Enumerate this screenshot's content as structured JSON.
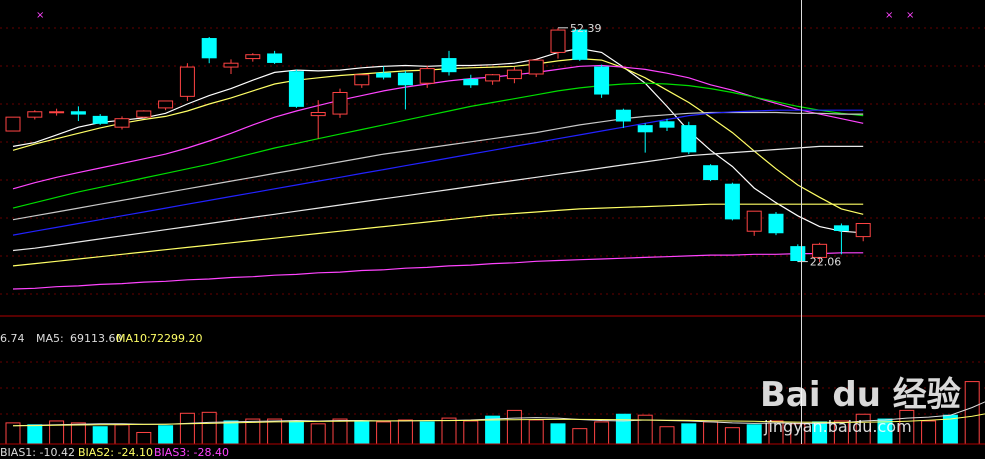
{
  "chart_data": {
    "type": "candlestick",
    "price": {
      "ylim": [
        15,
        56
      ],
      "candles": [
        {
          "o": 39.0,
          "h": 40.5,
          "c": 40.8,
          "l": 39.0
        },
        {
          "o": 40.8,
          "h": 41.7,
          "c": 41.5,
          "l": 40.5
        },
        {
          "o": 41.5,
          "h": 41.9,
          "c": 41.5,
          "l": 41.0
        },
        {
          "o": 41.5,
          "h": 42.2,
          "c": 41.2,
          "l": 40.3
        },
        {
          "o": 40.9,
          "h": 41.2,
          "c": 40.0,
          "l": 39.8
        },
        {
          "o": 39.5,
          "h": 40.9,
          "c": 40.6,
          "l": 39.2
        },
        {
          "o": 40.8,
          "h": 41.7,
          "c": 41.6,
          "l": 40.7
        },
        {
          "o": 42.0,
          "h": 42.8,
          "c": 42.9,
          "l": 41.7
        },
        {
          "o": 43.5,
          "h": 47.8,
          "c": 47.3,
          "l": 42.9
        },
        {
          "o": 51.0,
          "h": 51.2,
          "c": 48.5,
          "l": 47.8
        },
        {
          "o": 47.3,
          "h": 48.3,
          "c": 47.8,
          "l": 46.4
        },
        {
          "o": 48.4,
          "h": 49.1,
          "c": 48.9,
          "l": 48.0
        },
        {
          "o": 49.0,
          "h": 49.4,
          "c": 47.9,
          "l": 47.7
        },
        {
          "o": 46.7,
          "h": 47.0,
          "c": 42.2,
          "l": 42.0
        },
        {
          "o": 41.0,
          "h": 43.0,
          "c": 41.4,
          "l": 38.0
        },
        {
          "o": 41.2,
          "h": 44.5,
          "c": 44.0,
          "l": 40.7
        },
        {
          "o": 45.0,
          "h": 46.0,
          "c": 46.3,
          "l": 44.6
        },
        {
          "o": 46.5,
          "h": 47.4,
          "c": 46.0,
          "l": 45.7
        },
        {
          "o": 46.5,
          "h": 46.8,
          "c": 45.0,
          "l": 41.8
        },
        {
          "o": 45.2,
          "h": 47.5,
          "c": 47.1,
          "l": 44.6
        },
        {
          "o": 48.4,
          "h": 49.4,
          "c": 46.7,
          "l": 46.2
        },
        {
          "o": 45.7,
          "h": 46.3,
          "c": 45.0,
          "l": 44.6
        },
        {
          "o": 45.5,
          "h": 46.4,
          "c": 46.3,
          "l": 45.0
        },
        {
          "o": 45.8,
          "h": 47.3,
          "c": 46.9,
          "l": 45.2
        },
        {
          "o": 46.4,
          "h": 47.0,
          "c": 48.2,
          "l": 46.0
        },
        {
          "o": 49.2,
          "h": 52.4,
          "c": 52.1,
          "l": 48.4
        },
        {
          "o": 52.1,
          "h": 52.2,
          "c": 48.3,
          "l": 48.1
        },
        {
          "o": 47.3,
          "h": 47.6,
          "c": 43.8,
          "l": 43.3
        },
        {
          "o": 41.7,
          "h": 41.9,
          "c": 40.3,
          "l": 39.4
        },
        {
          "o": 39.7,
          "h": 40.0,
          "c": 38.9,
          "l": 36.2
        },
        {
          "o": 40.2,
          "h": 40.6,
          "c": 39.5,
          "l": 39.0
        },
        {
          "o": 39.7,
          "h": 40.2,
          "c": 36.3,
          "l": 36.0
        },
        {
          "o": 34.5,
          "h": 34.7,
          "c": 32.7,
          "l": 32.5
        },
        {
          "o": 32.1,
          "h": 32.3,
          "c": 27.6,
          "l": 27.4
        },
        {
          "o": 26.0,
          "h": 28.1,
          "c": 28.6,
          "l": 25.4
        },
        {
          "o": 28.2,
          "h": 28.5,
          "c": 25.8,
          "l": 25.5
        },
        {
          "o": 24.0,
          "h": 24.3,
          "c": 22.2,
          "l": 22.0
        },
        {
          "o": 22.6,
          "h": 24.5,
          "c": 24.3,
          "l": 22.0
        },
        {
          "o": 26.7,
          "h": 27.0,
          "c": 26.1,
          "l": 23.0
        },
        {
          "o": 25.3,
          "h": 26.3,
          "c": 27.0,
          "l": 24.7
        }
      ],
      "moving_averages": [
        {
          "color": "#ffffff",
          "values": [
            37.0,
            37.5,
            38.5,
            39.5,
            40.1,
            40.4,
            40.7,
            41.3,
            42.5,
            43.6,
            44.5,
            45.6,
            46.6,
            46.9,
            46.8,
            46.9,
            47.2,
            47.4,
            47.5,
            47.4,
            47.5,
            47.5,
            47.6,
            47.8,
            48.3,
            49.2,
            49.7,
            49.2,
            47.3,
            45.2,
            42.2,
            39.0,
            36.5,
            34.4,
            31.6,
            29.7,
            28.0,
            26.6,
            26.0,
            25.8
          ]
        },
        {
          "color": "#ffff66",
          "values": [
            36.5,
            37.3,
            38.0,
            38.7,
            39.4,
            40.0,
            40.5,
            40.9,
            41.6,
            42.5,
            43.3,
            44.2,
            45.1,
            45.6,
            45.9,
            46.2,
            46.4,
            46.6,
            46.8,
            46.9,
            47.1,
            47.2,
            47.3,
            47.4,
            47.7,
            48.1,
            48.4,
            48.2,
            47.2,
            45.9,
            44.3,
            42.7,
            40.8,
            38.8,
            36.4,
            34.1,
            32.0,
            30.4,
            28.9,
            28.2
          ]
        },
        {
          "color": "#ff44ff",
          "values": [
            31.5,
            32.3,
            33.0,
            33.6,
            34.2,
            34.8,
            35.4,
            36.0,
            36.8,
            37.7,
            38.7,
            39.8,
            40.8,
            41.6,
            42.3,
            43.0,
            43.6,
            44.2,
            44.7,
            45.1,
            45.5,
            45.8,
            46.0,
            46.3,
            46.6,
            47.0,
            47.4,
            47.5,
            47.3,
            47.0,
            46.5,
            45.9,
            45.0,
            44.3,
            43.4,
            42.6,
            41.8,
            41.2,
            40.6,
            40.0
          ]
        },
        {
          "color": "#00dd00",
          "values": [
            29.0,
            29.7,
            30.4,
            31.1,
            31.7,
            32.3,
            32.9,
            33.5,
            34.1,
            34.7,
            35.4,
            36.1,
            36.8,
            37.4,
            38.0,
            38.6,
            39.2,
            39.8,
            40.4,
            41.0,
            41.6,
            42.2,
            42.7,
            43.2,
            43.7,
            44.2,
            44.6,
            44.9,
            45.1,
            45.2,
            45.1,
            44.9,
            44.5,
            44.0,
            43.4,
            42.8,
            42.2,
            41.7,
            41.3,
            41.0
          ]
        },
        {
          "color": "#c8c8c8",
          "values": [
            27.5,
            28.0,
            28.5,
            29.0,
            29.5,
            30.0,
            30.5,
            31.0,
            31.5,
            32.0,
            32.5,
            33.0,
            33.5,
            34.0,
            34.5,
            35.0,
            35.5,
            36.0,
            36.4,
            36.8,
            37.2,
            37.6,
            38.0,
            38.4,
            38.8,
            39.3,
            39.8,
            40.2,
            40.6,
            40.9,
            41.1,
            41.3,
            41.4,
            41.4,
            41.4,
            41.4,
            41.3,
            41.3,
            41.2,
            41.2
          ]
        },
        {
          "color": "#2222ff",
          "values": [
            25.5,
            26.0,
            26.5,
            27.0,
            27.5,
            28.0,
            28.5,
            29.0,
            29.5,
            30.0,
            30.5,
            31.0,
            31.5,
            32.0,
            32.5,
            33.0,
            33.5,
            34.0,
            34.5,
            35.0,
            35.5,
            36.0,
            36.5,
            37.0,
            37.5,
            38.0,
            38.5,
            39.0,
            39.5,
            40.0,
            40.5,
            41.0,
            41.3,
            41.5,
            41.6,
            41.7,
            41.7,
            41.7,
            41.7,
            41.7
          ]
        },
        {
          "color": "#e8e8e8",
          "values": [
            23.5,
            23.8,
            24.2,
            24.6,
            25.0,
            25.4,
            25.8,
            26.2,
            26.6,
            27.0,
            27.4,
            27.8,
            28.2,
            28.6,
            29.0,
            29.4,
            29.8,
            30.2,
            30.6,
            31.0,
            31.4,
            31.8,
            32.2,
            32.6,
            33.0,
            33.4,
            33.8,
            34.2,
            34.6,
            35.0,
            35.4,
            35.8,
            36.0,
            36.2,
            36.4,
            36.6,
            36.8,
            37.0,
            37.0,
            37.0
          ]
        },
        {
          "color": "#ffff66",
          "values": [
            21.5,
            21.8,
            22.1,
            22.4,
            22.7,
            23.0,
            23.3,
            23.6,
            23.9,
            24.2,
            24.5,
            24.8,
            25.1,
            25.4,
            25.7,
            26.0,
            26.3,
            26.6,
            26.9,
            27.2,
            27.5,
            27.8,
            28.1,
            28.3,
            28.5,
            28.7,
            28.9,
            29.0,
            29.1,
            29.2,
            29.3,
            29.4,
            29.5,
            29.5,
            29.5,
            29.5,
            29.5,
            29.5,
            29.5,
            29.5
          ]
        },
        {
          "color": "#ff44ff",
          "values": [
            18.5,
            18.6,
            18.8,
            18.9,
            19.1,
            19.2,
            19.4,
            19.5,
            19.7,
            19.8,
            20.0,
            20.1,
            20.3,
            20.4,
            20.6,
            20.7,
            20.9,
            21.0,
            21.2,
            21.3,
            21.5,
            21.6,
            21.8,
            21.9,
            22.1,
            22.2,
            22.3,
            22.4,
            22.5,
            22.6,
            22.7,
            22.8,
            22.9,
            22.9,
            23.0,
            23.0,
            23.1,
            23.1,
            23.2,
            23.2
          ]
        }
      ],
      "annotations": [
        {
          "text": "52.39",
          "candle": 25,
          "value": 52.39
        },
        {
          "text": "22.06",
          "candle": 36,
          "value": 22.06
        }
      ]
    },
    "volume": {
      "ylim": [
        0,
        100000
      ],
      "bars": [
        22000,
        20000,
        24000,
        22000,
        18000,
        20000,
        12000,
        19000,
        32000,
        33000,
        24000,
        26000,
        26000,
        24000,
        21000,
        26000,
        24000,
        23000,
        25000,
        23000,
        27000,
        24000,
        29000,
        35000,
        25000,
        21000,
        16000,
        23000,
        31000,
        30000,
        18000,
        21000,
        23000,
        17000,
        20000,
        24000,
        21000,
        23000,
        24000,
        31000,
        26000,
        35000,
        24000,
        30000,
        65000,
        90000
      ],
      "ma5": [
        19000,
        19500,
        20000,
        20500,
        21000,
        21000,
        20500,
        20500,
        21500,
        22500,
        23000,
        23500,
        24000,
        24500,
        24000,
        24500,
        24500,
        24000,
        24000,
        24500,
        24500,
        25000,
        26000,
        27000,
        27500,
        27000,
        25500,
        24500,
        24000,
        25000,
        24500,
        24000,
        23000,
        22000,
        21500,
        22000,
        21500,
        21500,
        22000,
        24000,
        25000,
        27000,
        28000,
        30000,
        38000,
        48000
      ],
      "ma10": [
        19000,
        19200,
        19500,
        19800,
        20000,
        20200,
        20400,
        20600,
        21000,
        21500,
        22000,
        22500,
        23000,
        23200,
        23500,
        23800,
        24000,
        24100,
        24200,
        24300,
        24400,
        24600,
        25000,
        25300,
        25500,
        25600,
        25600,
        25500,
        25200,
        25000,
        24800,
        24600,
        24300,
        24000,
        23600,
        23200,
        22800,
        22600,
        22500,
        22700,
        23000,
        23800,
        24800,
        26000,
        29000,
        33000
      ]
    },
    "legend_row1": {
      "prefix": "6.74",
      "ma5_label": "MA5:",
      "ma5_value": "69113.60",
      "ma10_label": "MA10:",
      "ma10_value": "72299.20"
    },
    "legend_row2": {
      "bias1": "BIAS1: -10.42",
      "bias2": "BIAS2: -24.10",
      "bias3": "BIAS3: -28.40"
    }
  },
  "colors": {
    "up": "#ff4444",
    "down": "#00ffff",
    "axis": "#b00000",
    "cursor": "#dddddd",
    "magenta": "#ff44ff"
  },
  "watermark": {
    "brand": "Bai du 经验",
    "url": "jingyan.baidu.com"
  }
}
